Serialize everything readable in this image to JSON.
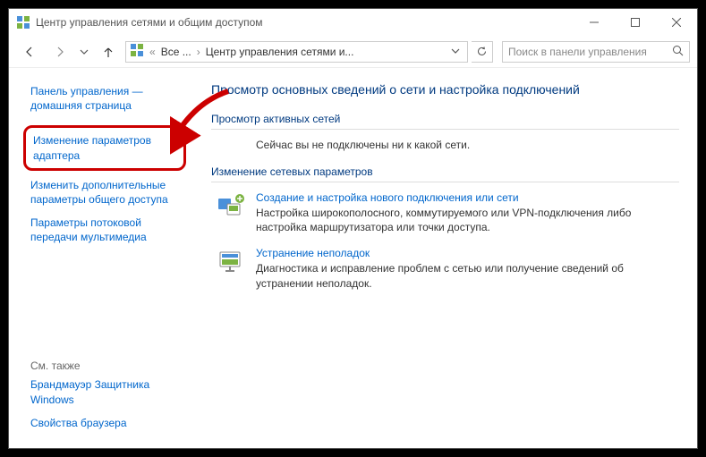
{
  "window": {
    "title": "Центр управления сетями и общим доступом"
  },
  "breadcrumb": {
    "part1": "Все ...",
    "part2": "Центр управления сетями и..."
  },
  "search": {
    "placeholder": "Поиск в панели управления"
  },
  "sidebar": {
    "home": "Панель управления — домашняя страница",
    "adapter": "Изменение параметров адаптера",
    "sharing": "Изменить дополнительные параметры общего доступа",
    "streaming": "Параметры потоковой передачи мультимедиа",
    "see_also": "См. также",
    "firewall": "Брандмауэр Защитника Windows",
    "inet": "Свойства браузера"
  },
  "content": {
    "title": "Просмотр основных сведений о сети и настройка подключений",
    "active_h": "Просмотр активных сетей",
    "active_msg": "Сейчас вы не подключены ни к какой сети.",
    "change_h": "Изменение сетевых параметров",
    "task1_link": "Создание и настройка нового подключения или сети",
    "task1_desc": "Настройка широкополосного, коммутируемого или VPN-подключения либо настройка маршрутизатора или точки доступа.",
    "task2_link": "Устранение неполадок",
    "task2_desc": "Диагностика и исправление проблем с сетью или получение сведений об устранении неполадок."
  }
}
